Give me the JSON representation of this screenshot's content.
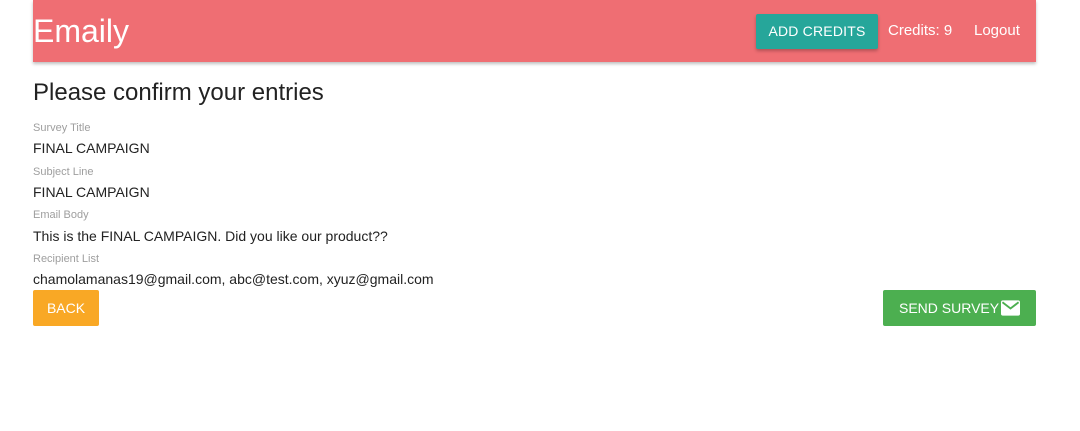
{
  "header": {
    "brand": "Emaily",
    "add_credits_label": "ADD CREDITS",
    "credits_text": "Credits: 9",
    "logout_label": "Logout"
  },
  "main": {
    "title": "Please confirm your entries",
    "fields": [
      {
        "label": "Survey Title",
        "value": "FINAL CAMPAIGN"
      },
      {
        "label": "Subject Line",
        "value": "FINAL CAMPAIGN"
      },
      {
        "label": "Email Body",
        "value": "This is the FINAL CAMPAIGN. Did you like our product??"
      },
      {
        "label": "Recipient List",
        "value": "chamolamanas19@gmail.com, abc@test.com, xyuz@gmail.com"
      }
    ],
    "back_label": "BACK",
    "send_label": "SEND SURVEY",
    "send_icon": "email-icon"
  },
  "colors": {
    "navbar": "#ef6e73",
    "add_credits": "#26a69a",
    "back_button": "#f9a825",
    "send_button": "#4caf50"
  }
}
